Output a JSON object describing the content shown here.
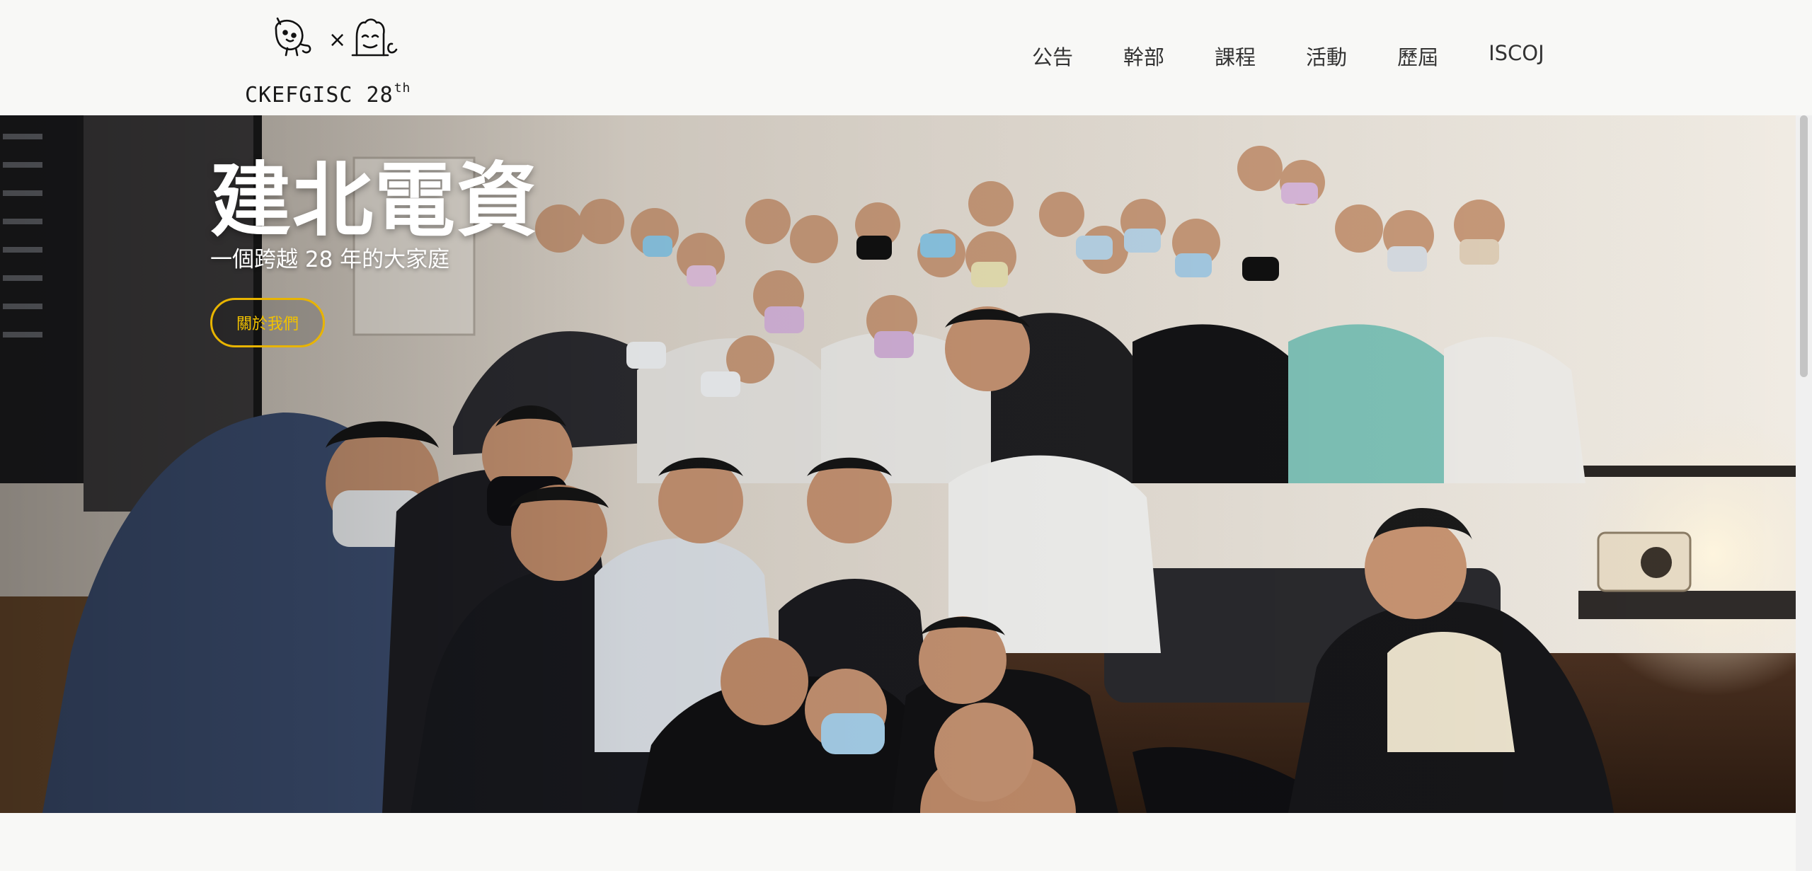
{
  "brand": {
    "logo_separator": "×",
    "name": "CKEFGISC 28",
    "superscript": "th"
  },
  "nav": {
    "items": [
      {
        "label": "公告"
      },
      {
        "label": "幹部"
      },
      {
        "label": "課程"
      },
      {
        "label": "活動"
      },
      {
        "label": "歷屆"
      },
      {
        "label": "ISCOJ"
      }
    ]
  },
  "hero": {
    "title": "建北電資",
    "subtitle": "一個跨越 28 年的大家庭",
    "button_label": "關於我們",
    "button_color": "#e8b400",
    "photo_icon": "group-photo-image"
  },
  "colors": {
    "page_background": "#f8f8f6",
    "accent": "#f2c200",
    "nav_text": "#333333"
  }
}
